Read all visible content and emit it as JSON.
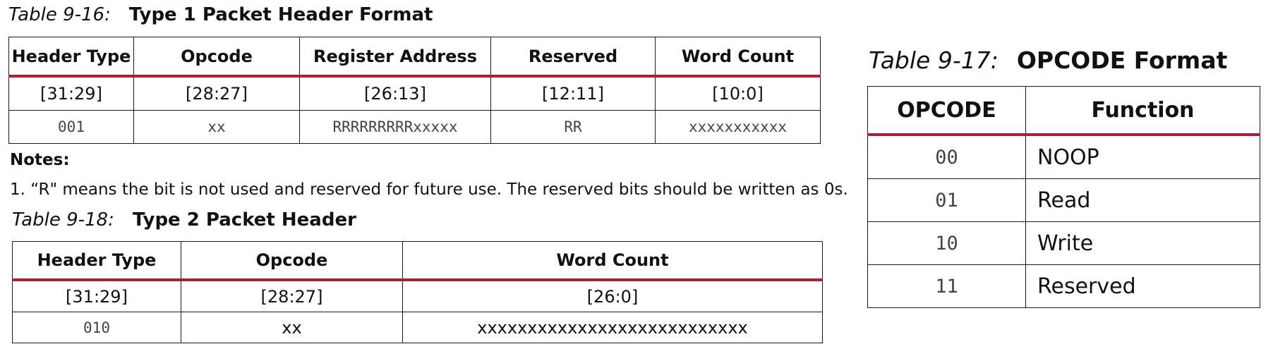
{
  "table16": {
    "number": "Table 9-16:",
    "title": "Type 1 Packet Header Format",
    "headers": [
      "Header Type",
      "Opcode",
      "Register Address",
      "Reserved",
      "Word Count"
    ],
    "bits": [
      "[31:29]",
      "[28:27]",
      "[26:13]",
      "[12:11]",
      "[10:0]"
    ],
    "values": [
      "001",
      "xx",
      "RRRRRRRRRxxxxx",
      "RR",
      "xxxxxxxxxxx"
    ]
  },
  "notes": {
    "title": "Notes:",
    "items": [
      "1.  “R\" means the bit is not used and reserved for future use. The reserved bits should be written as 0s."
    ]
  },
  "table18": {
    "number": "Table 9-18:",
    "title": "Type 2 Packet Header",
    "headers": [
      "Header Type",
      "Opcode",
      "Word Count"
    ],
    "bits": [
      "[31:29]",
      "[28:27]",
      "[26:0]"
    ],
    "values": [
      "010",
      "xx",
      "xxxxxxxxxxxxxxxxxxxxxxxxxxx"
    ]
  },
  "table17": {
    "number": "Table 9-17:",
    "title": "OPCODE Format",
    "headers": [
      "OPCODE",
      "Function"
    ],
    "rows": [
      [
        "00",
        "NOOP"
      ],
      [
        "01",
        "Read"
      ],
      [
        "10",
        "Write"
      ],
      [
        "11",
        "Reserved"
      ]
    ]
  }
}
